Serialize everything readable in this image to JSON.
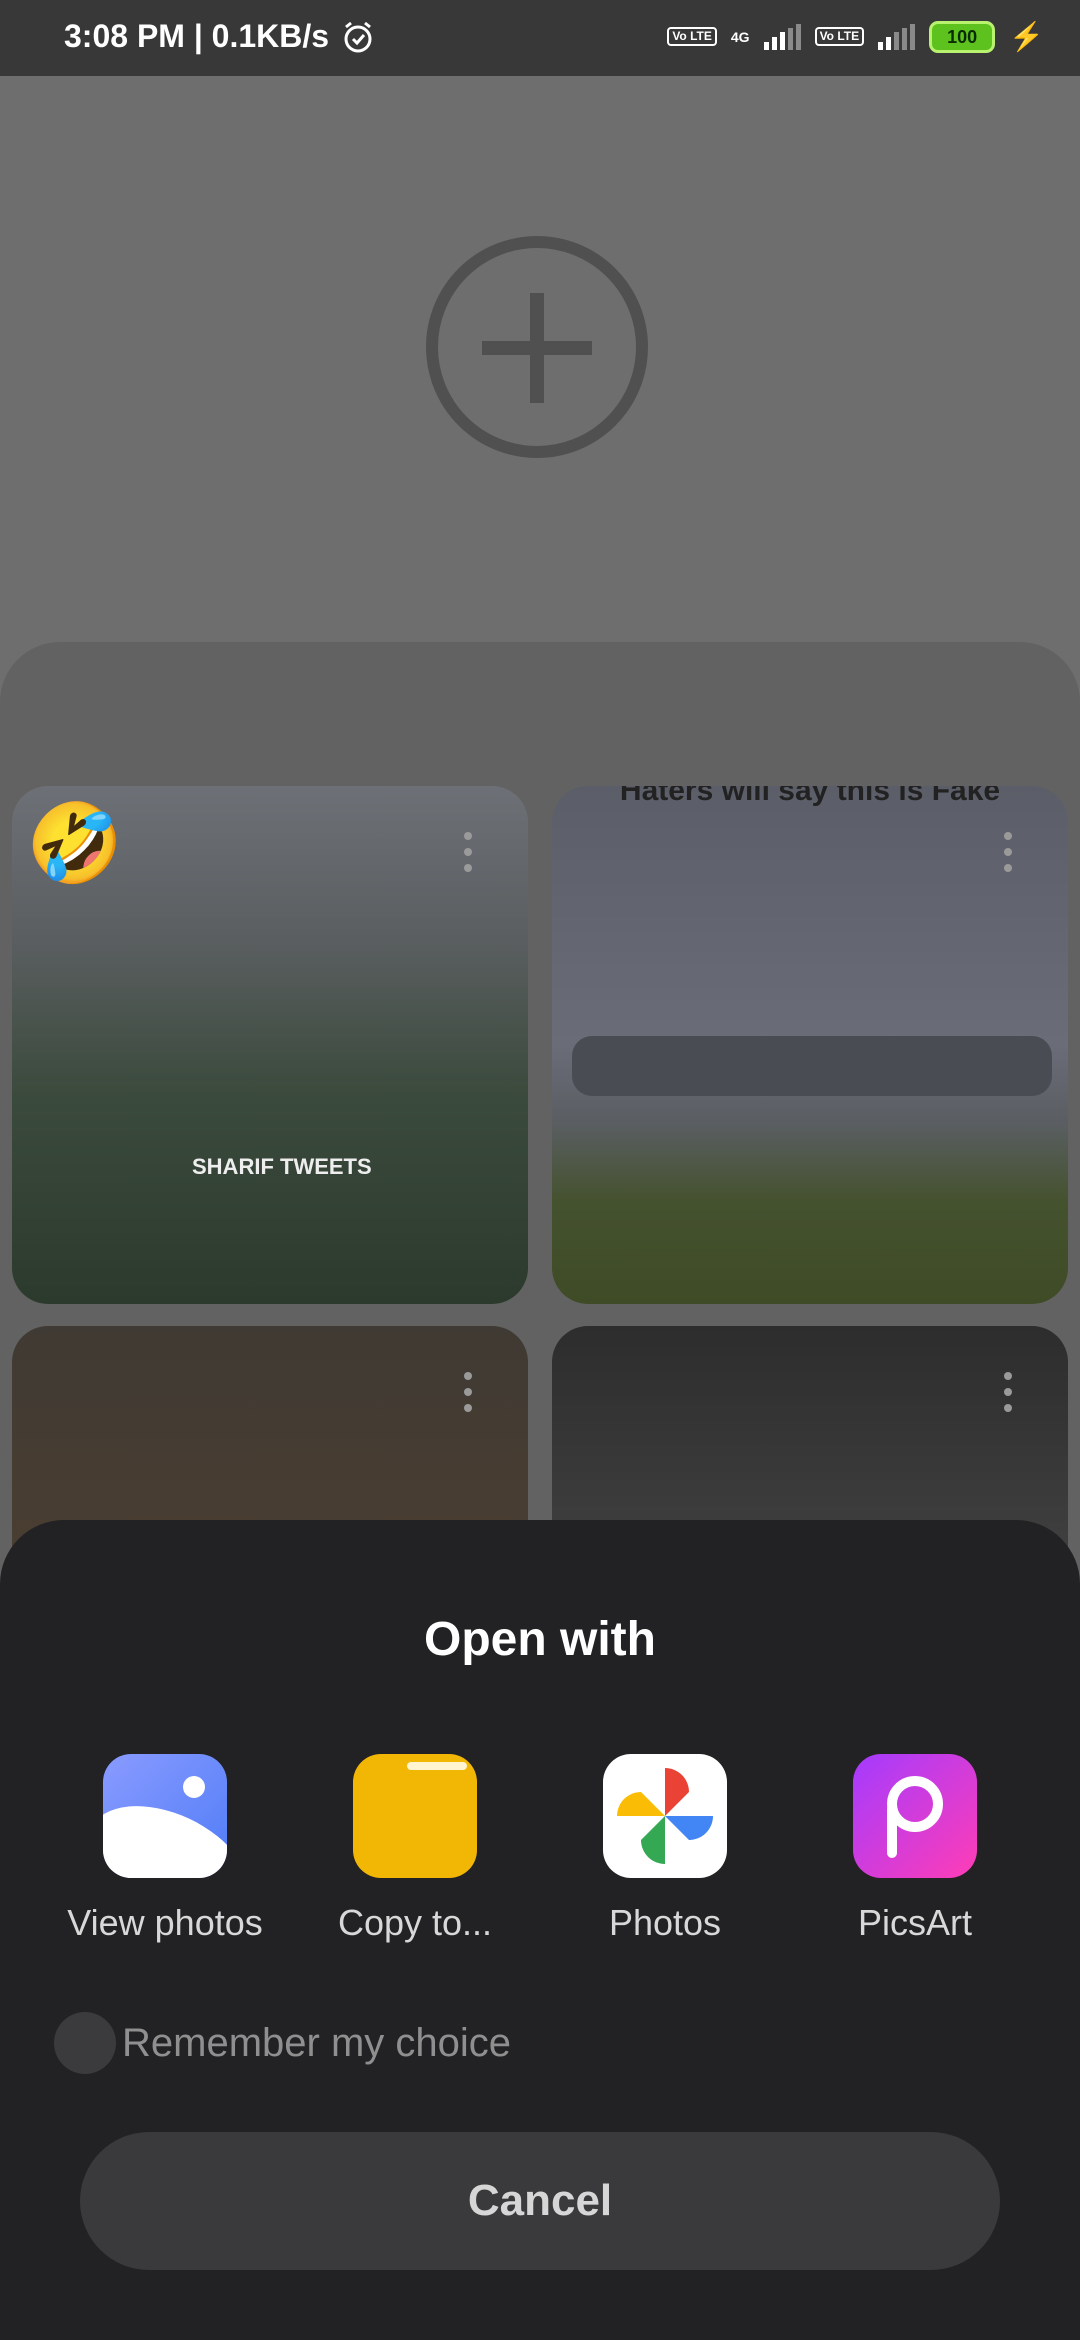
{
  "status_bar": {
    "time_speed": "3:08 PM | 0.1KB/s",
    "network_label_1": "Vo LTE",
    "network_type": "4G",
    "network_label_2": "Vo LTE",
    "battery": "100"
  },
  "background": {
    "tile2_caption": "Haters will say this is Fake",
    "tile1_tag": "SHARIF TWEETS"
  },
  "sheet": {
    "title": "Open with",
    "apps": [
      {
        "label": "View photos",
        "icon": "gallery-icon"
      },
      {
        "label": "Copy to...",
        "icon": "folder-icon"
      },
      {
        "label": "Photos",
        "icon": "google-photos-icon"
      },
      {
        "label": "PicsArt",
        "icon": "picsart-icon"
      }
    ],
    "remember_label": "Remember my choice",
    "remember_checked": false,
    "cancel_label": "Cancel"
  }
}
